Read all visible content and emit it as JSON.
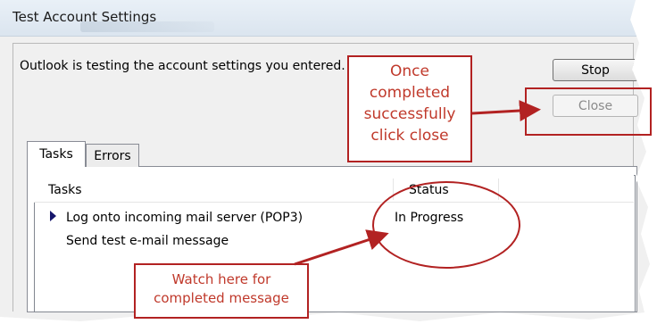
{
  "window": {
    "title": "Test Account Settings"
  },
  "message": "Outlook is testing the account settings you entered.",
  "buttons": {
    "stop": "Stop",
    "close": "Close"
  },
  "tabs": [
    "Tasks",
    "Errors"
  ],
  "list": {
    "headers": {
      "tasks": "Tasks",
      "status": "Status"
    },
    "rows": [
      {
        "task": "Log onto incoming mail server (POP3)",
        "status": "In Progress"
      },
      {
        "task": "Send test e-mail message",
        "status": ""
      }
    ]
  },
  "annotations": {
    "close_note": [
      "Once",
      "completed",
      "successfully",
      "click close"
    ],
    "watch_note": [
      "Watch here for",
      "completed message"
    ]
  },
  "colors": {
    "annotation": "#b22222",
    "annotation_text": "#c0392b",
    "row_arrow": "#16166b"
  }
}
